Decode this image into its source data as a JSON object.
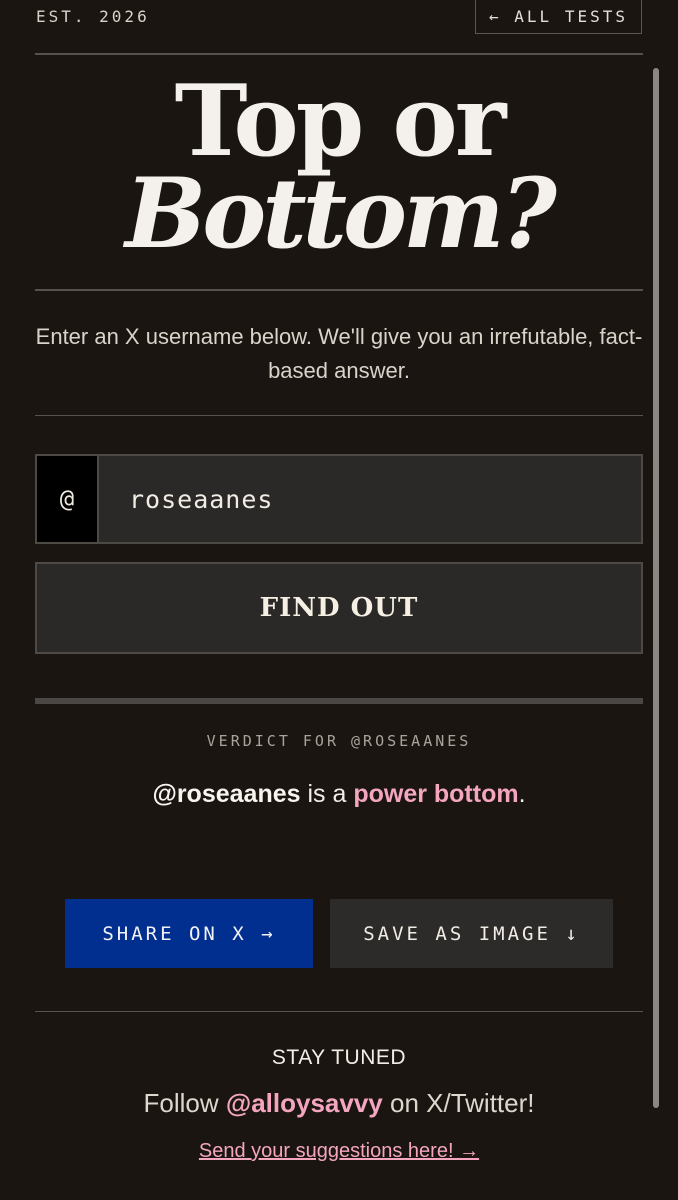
{
  "header": {
    "est": "EST. 2026",
    "all_tests": "← ALL TESTS"
  },
  "title": {
    "line1": "Top or",
    "line2": "Bottom?"
  },
  "intro": "Enter an X username below. We'll give you an irrefutable, fact-based answer.",
  "form": {
    "prefix": "@",
    "username": "roseaanes",
    "submit": "FIND OUT"
  },
  "verdict": {
    "label": "VERDICT FOR @ROSEAANES",
    "handle": "@roseaanes",
    "connector": " is a ",
    "result": "power bottom",
    "end": "."
  },
  "actions": {
    "share": "SHARE ON X →",
    "save": "SAVE AS IMAGE ↓"
  },
  "footer": {
    "stay_tuned": "STAY TUNED",
    "follow_prefix": "Follow ",
    "follow_handle": "@alloysavvy",
    "follow_suffix": " on X/Twitter!",
    "suggest": "Send your suggestions here! →"
  },
  "colors": {
    "background": "#1a1510",
    "accent_pink": "#f4a5c0",
    "share_blue": "#002f8f"
  }
}
